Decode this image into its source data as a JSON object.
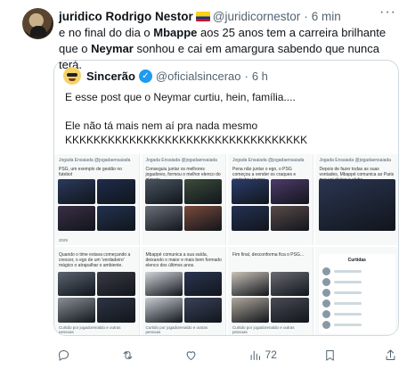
{
  "tweet": {
    "author_name": "juridico Rodrigo Nestor",
    "author_handle": "@juridicornestor",
    "separator": "·",
    "time": "6 min",
    "text_part1": "e no final do dia o ",
    "text_bold1": "Mbappe",
    "text_part2": " aos 25 anos tem a carreira brilhante que o ",
    "text_bold2": "Neymar",
    "text_part3": " sonhou e cai em amargura sabendo que nunca terá."
  },
  "quote": {
    "author_name": "Sincerão",
    "author_handle": "@oficialsincerao",
    "separator": "·",
    "time": "6 h",
    "line1": "E esse post que o Neymar curtiu, hein, família....",
    "line2": "Ele não tá mais nem aí pra nada mesmo",
    "line3": "KKKKKKKKKKKKKKKKKKKKKKKKKKKKKKKKKK",
    "panels": [
      {
        "handle": "Jogada Ensaiada @jogadaensaiada",
        "caption": "PSG, um exemplo de gestão no futebol",
        "images": [
          "#2a3a5c",
          "#1e2c4a",
          "#3b2f45",
          "#22324f"
        ],
        "layout": "g2",
        "footer": "2025"
      },
      {
        "handle": "Jogada Ensaiada @jogadaensaiada",
        "caption": "Conseguiu juntar os melhores jogadores, formou o melhor elenco do planeta.",
        "images": [
          "#4a5560",
          "#3c4c3a",
          "#6b6f78",
          "#7a4a3a"
        ],
        "layout": "g2",
        "footer": ""
      },
      {
        "handle": "Jogada Ensaiada @jogadaensaiada",
        "caption": "Pena não juntar o ego, o PSG começou a vender os craques e contratou jovens...",
        "images": [
          "#2b3d6b",
          "#4f3a6a",
          "#243152",
          "#5a4a4a"
        ],
        "layout": "g2",
        "footer": ""
      },
      {
        "handle": "Jogada Ensaiada @jogadaensaiada",
        "caption": "Depois de fazer todas as suas vontades, Mbappé comunica ao Paris que vai deixar o clube.",
        "images": [
          "#2a3550"
        ],
        "layout": "g1",
        "footer": ""
      },
      {
        "handle": "",
        "caption": "Quando o time estava começando a crescer, o ego de um 'verdadeiro' mágico o atrapalhar o ambiente.",
        "images": [
          "#5a6470",
          "#3a3a44",
          "#8a8f96",
          "#2e3444"
        ],
        "layout": "g2",
        "footer": "Curtido por jogadorenaldo e outras pessoas"
      },
      {
        "handle": "",
        "caption": "Mbappé comunica a sua saída, deixando o maior e mais bem formado elenco dos últimos anos.",
        "images": [
          "#d0d4d8",
          "#2b3550",
          "#c8ccd2",
          "#3a4258"
        ],
        "layout": "g2",
        "footer": "Curtido por jogadorenaldo e outras pessoas"
      },
      {
        "handle": "",
        "caption": "Fim final, desconforma fica o PSG...",
        "images": [
          "#c9c2b8",
          "#6a6a72",
          "#b0a89c",
          "#4a4a54"
        ],
        "layout": "g2",
        "footer": "Curtido por jogadorenaldo e outras pessoas"
      },
      {
        "handle": "",
        "caption": "Curtidas",
        "images": [],
        "layout": "list",
        "footer": ""
      }
    ]
  },
  "actions": {
    "reply_count": "",
    "retweet_count": "",
    "like_count": "",
    "views_count": "72"
  }
}
